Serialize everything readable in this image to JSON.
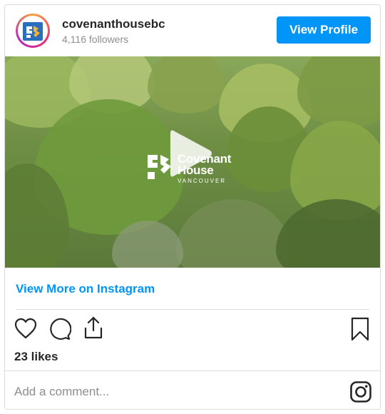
{
  "header": {
    "username": "covenanthousebc",
    "followers": "4,116 followers",
    "view_profile_label": "View Profile"
  },
  "media": {
    "brand_line1": "Covenant",
    "brand_line2": "House",
    "brand_line3": "VANCOUVER"
  },
  "links": {
    "view_more": "View More on Instagram"
  },
  "actions": {
    "likes": "23 likes"
  },
  "comment": {
    "placeholder": "Add a comment..."
  },
  "colors": {
    "accent": "#0095f6",
    "text": "#262626",
    "muted": "#8e8e8e",
    "border": "#dbdbdb"
  },
  "icons": [
    "avatar-logo-icon",
    "play-icon",
    "heart-icon",
    "comment-icon",
    "share-icon",
    "bookmark-icon",
    "instagram-icon"
  ]
}
